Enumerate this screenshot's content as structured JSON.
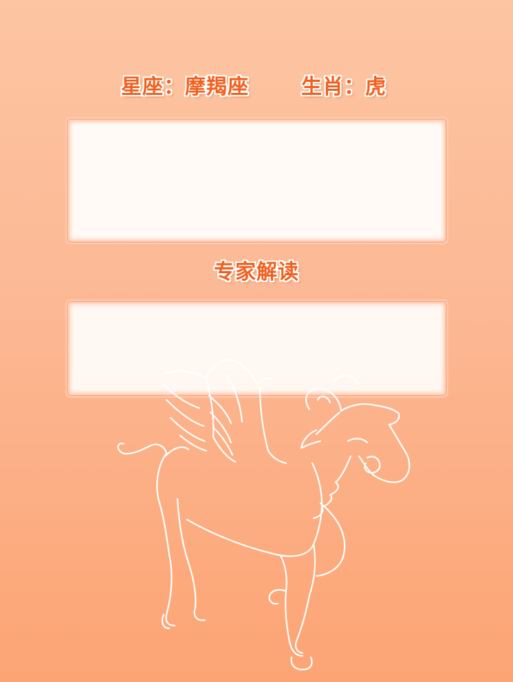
{
  "header": {
    "zodiac_label": "星座：摩羯座",
    "animal_label": "生肖：虎"
  },
  "content_panel": {
    "text": ""
  },
  "expert_section": {
    "title": "专家解读",
    "text": ""
  },
  "illustration": {
    "icon": "winged-goat-outline-icon"
  },
  "colors": {
    "background_top": "#fdc5a2",
    "background_bottom": "#fca474",
    "heading": "#f2601f",
    "panel": "#fffaf6",
    "panel_border": "#ffb08a"
  }
}
